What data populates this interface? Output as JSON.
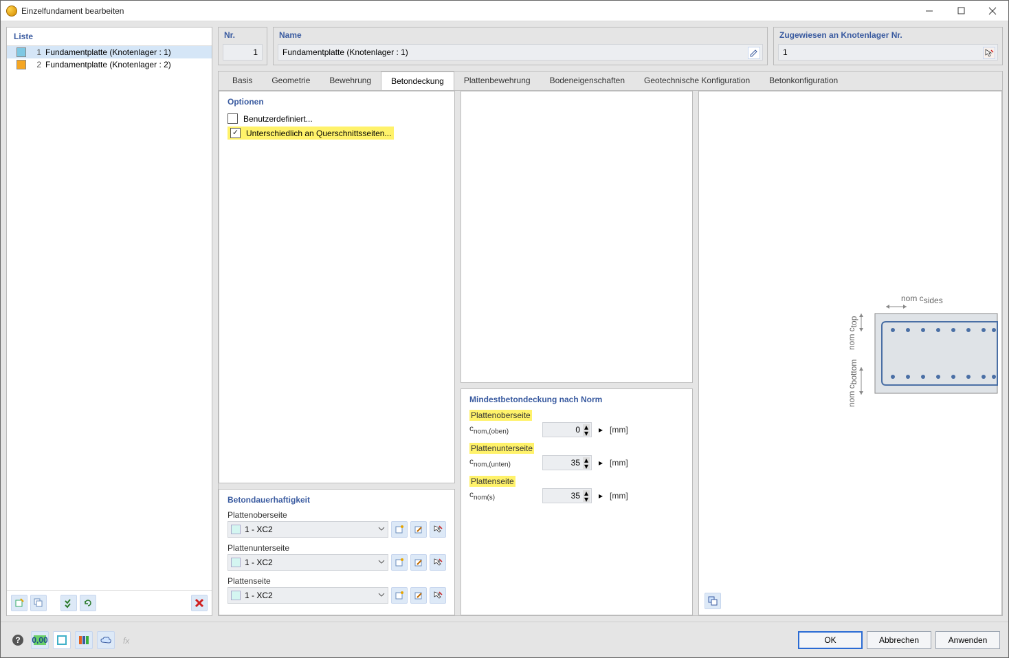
{
  "window": {
    "title": "Einzelfundament bearbeiten"
  },
  "left": {
    "header": "Liste",
    "items": [
      {
        "num": "1",
        "label": "Fundamentplatte (Knotenlager : 1)",
        "color": "#7ec8e3",
        "selected": true
      },
      {
        "num": "2",
        "label": "Fundamentplatte (Knotenlager : 2)",
        "color": "#f5a623",
        "selected": false
      }
    ]
  },
  "header": {
    "nr_label": "Nr.",
    "nr_value": "1",
    "name_label": "Name",
    "name_value": "Fundamentplatte (Knotenlager : 1)",
    "assign_label": "Zugewiesen an Knotenlager Nr.",
    "assign_value": "1"
  },
  "tabs": [
    {
      "label": "Basis"
    },
    {
      "label": "Geometrie"
    },
    {
      "label": "Bewehrung"
    },
    {
      "label": "Betondeckung",
      "active": true
    },
    {
      "label": "Plattenbewehrung"
    },
    {
      "label": "Bodeneigenschaften"
    },
    {
      "label": "Geotechnische Konfiguration"
    },
    {
      "label": "Betonkonfiguration"
    }
  ],
  "options": {
    "title": "Optionen",
    "user_defined": {
      "label": "Benutzerdefiniert...",
      "checked": false
    },
    "diff_sides": {
      "label": "Unterschiedlich an Querschnittsseiten...",
      "checked": true,
      "highlight": true
    }
  },
  "durability": {
    "title": "Betondauerhaftigkeit",
    "rows": [
      {
        "label": "Plattenoberseite",
        "value": "1 - XC2"
      },
      {
        "label": "Plattenunterseite",
        "value": "1 - XC2"
      },
      {
        "label": "Plattenseite",
        "value": "1 - XC2"
      }
    ]
  },
  "min_cover": {
    "title": "Mindestbetondeckung nach Norm",
    "rows": [
      {
        "section": "Plattenoberseite",
        "symbol": "cnom,(oben)",
        "value": "0",
        "unit": "[mm]"
      },
      {
        "section": "Plattenunterseite",
        "symbol": "cnom,(unten)",
        "value": "35",
        "unit": "[mm]"
      },
      {
        "section": "Plattenseite",
        "symbol": "cnom(s)",
        "value": "35",
        "unit": "[mm]"
      }
    ]
  },
  "buttons": {
    "ok": "OK",
    "cancel": "Abbrechen",
    "apply": "Anwenden"
  },
  "diagram": {
    "nom_top": "nom c",
    "top_sub": "top",
    "nom_sides": "nom c",
    "sides_sub": "sides",
    "nom_bottom": "nom c",
    "bottom_sub": "bottom"
  }
}
